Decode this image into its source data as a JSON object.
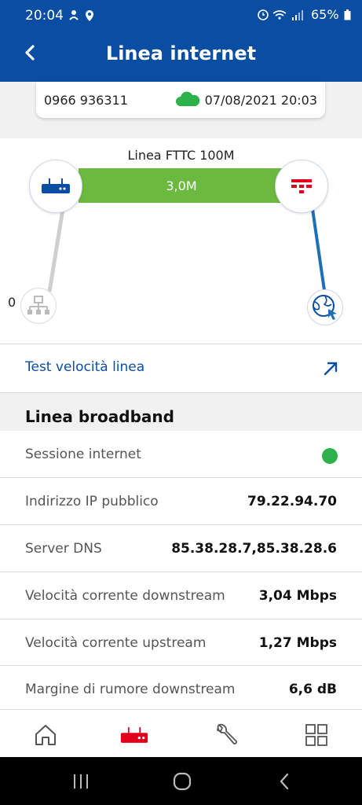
{
  "status_bar": {
    "time": "20:04",
    "battery": "65%"
  },
  "header": {
    "title": "Linea internet"
  },
  "line_card": {
    "phone": "0966 936311",
    "date": "07/08/2021 20:03"
  },
  "diagram": {
    "line_name": "Linea FTTC 100M",
    "speed": "3,0M",
    "lan_devices": "0",
    "colors": {
      "bar": "#6cb93f",
      "brand_blue": "#0a4ea3",
      "brand_red": "#e2001a"
    }
  },
  "test_speed": {
    "label": "Test velocità linea"
  },
  "broadband": {
    "title": "Linea broadband",
    "rows": [
      {
        "label": "Sessione internet",
        "value": ""
      },
      {
        "label": "Indirizzo IP pubblico",
        "value": "79.22.94.70"
      },
      {
        "label": "Server DNS",
        "value": "85.38.28.7,85.38.28.6"
      },
      {
        "label": "Velocità corrente downstream",
        "value": "3,04 Mbps"
      },
      {
        "label": "Velocità corrente upstream",
        "value": "1,27 Mbps"
      },
      {
        "label": "Margine di rumore downstream",
        "value": "6,6 dB"
      }
    ]
  },
  "bottom_nav": [
    "home-icon",
    "router-icon",
    "wrench-icon",
    "grid-icon"
  ],
  "system_nav": [
    "recents-icon",
    "home-circle-icon",
    "back-chevron-icon"
  ]
}
